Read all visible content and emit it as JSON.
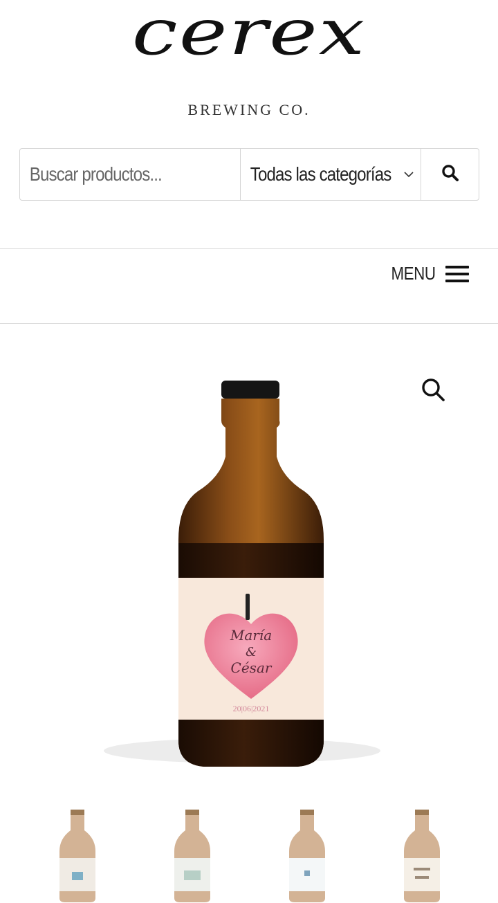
{
  "brand": {
    "name": "cerex",
    "tagline": "BREWING CO."
  },
  "search": {
    "placeholder": "Buscar productos...",
    "category_selected": "Todas las categorías",
    "submit_icon": "search-icon"
  },
  "nav": {
    "menu_label": "MENU",
    "menu_icon": "hamburger-icon"
  },
  "product": {
    "zoom_icon": "magnifier-icon",
    "label_names": [
      "María",
      "&",
      "César"
    ],
    "label_date": "20|06|2021"
  },
  "colors": {
    "bottle": "#6b3a12",
    "label": "#f7e6d8",
    "heart": "#ec7f96",
    "text": "#222222"
  }
}
